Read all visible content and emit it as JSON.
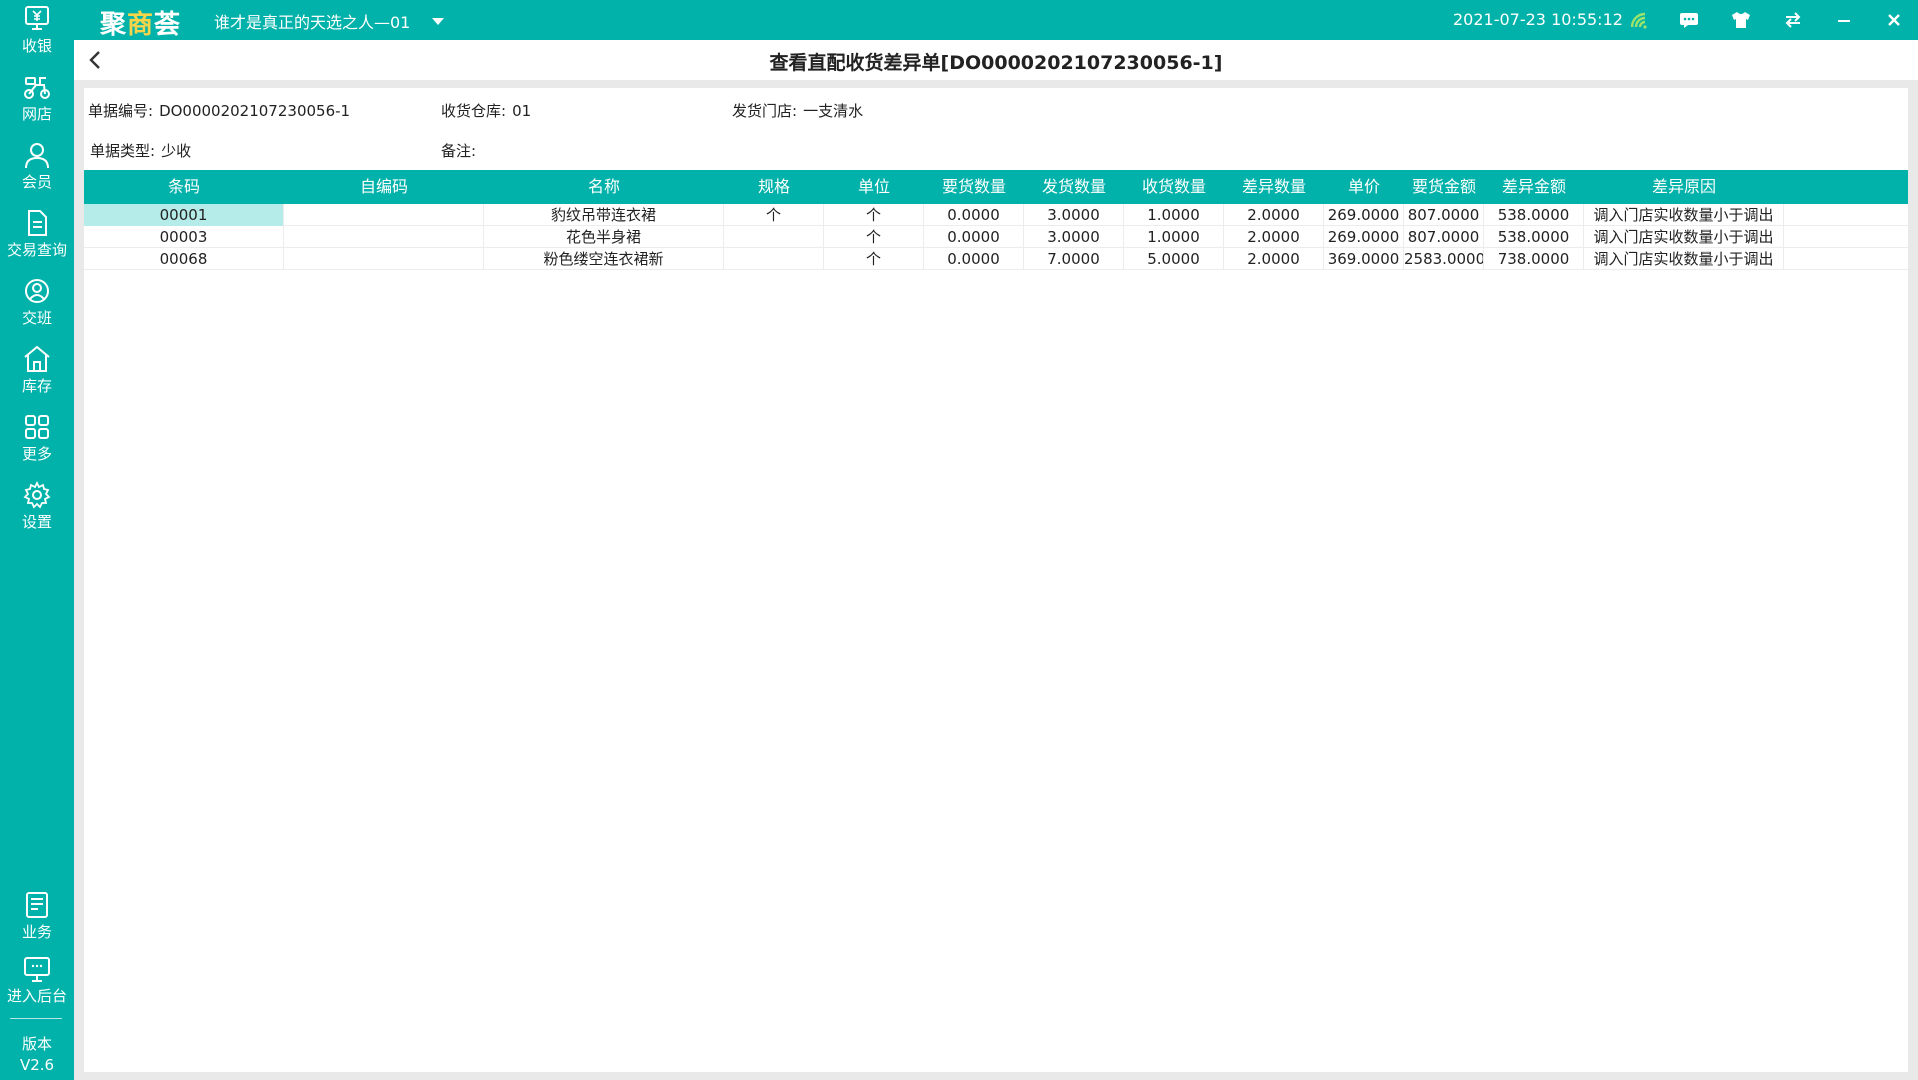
{
  "app": {
    "logo_text_a": "聚",
    "logo_text_b": "商",
    "logo_text_c": "荟",
    "store_name": "谁才是真正的天选之人—01",
    "datetime": "2021-07-23 10:55:12"
  },
  "colors": {
    "brand": "#00b2a9",
    "selected_cell": "#b5ebe8",
    "logo_accent": "#f6d54a"
  },
  "topbar_icons": [
    "wifi-signal-icon",
    "message-icon",
    "shirt-icon",
    "switch-icon",
    "minimize-icon",
    "close-icon"
  ],
  "sidebar": {
    "items": [
      {
        "label": "收银",
        "icon": "cashier-icon"
      },
      {
        "label": "网店",
        "icon": "scooter-icon"
      },
      {
        "label": "会员",
        "icon": "member-icon"
      },
      {
        "label": "交易查询",
        "icon": "document-icon"
      },
      {
        "label": "交班",
        "icon": "handover-icon"
      },
      {
        "label": "库存",
        "icon": "warehouse-icon"
      },
      {
        "label": "更多",
        "icon": "grid-icon"
      },
      {
        "label": "设置",
        "icon": "gear-icon"
      },
      {
        "label": "业务",
        "icon": "business-icon"
      },
      {
        "label": "进入后台",
        "icon": "monitor-icon"
      }
    ],
    "version_label": "版本",
    "version": "V2.6"
  },
  "page": {
    "title": "查看直配收货差异单[DO0000202107230056-1]",
    "info": {
      "doc_no_label": "单据编号:",
      "doc_no": "DO0000202107230056-1",
      "warehouse_label": "收货仓库:",
      "warehouse": "01",
      "ship_store_label": "发货门店:",
      "ship_store": "一支清水",
      "doc_type_label": "单据类型:",
      "doc_type": "少收",
      "remark_label": "备注:",
      "remark": ""
    }
  },
  "table": {
    "headers": [
      "条码",
      "自编码",
      "名称",
      "规格",
      "单位",
      "要货数量",
      "发货数量",
      "收货数量",
      "差异数量",
      "单价",
      "要货金额",
      "差异金额",
      "差异原因"
    ],
    "rows": [
      [
        "00001",
        "",
        "豹纹吊带连衣裙",
        "个",
        "个",
        "0.0000",
        "3.0000",
        "1.0000",
        "2.0000",
        "269.0000",
        "807.0000",
        "538.0000",
        "调入门店实收数量小于调出"
      ],
      [
        "00003",
        "",
        "花色半身裙",
        "",
        "个",
        "0.0000",
        "3.0000",
        "1.0000",
        "2.0000",
        "269.0000",
        "807.0000",
        "538.0000",
        "调入门店实收数量小于调出"
      ],
      [
        "00068",
        "",
        "粉色缕空连衣裙新",
        "",
        "个",
        "0.0000",
        "7.0000",
        "5.0000",
        "2.0000",
        "369.0000",
        "2583.0000",
        "738.0000",
        "调入门店实收数量小于调出"
      ]
    ]
  }
}
